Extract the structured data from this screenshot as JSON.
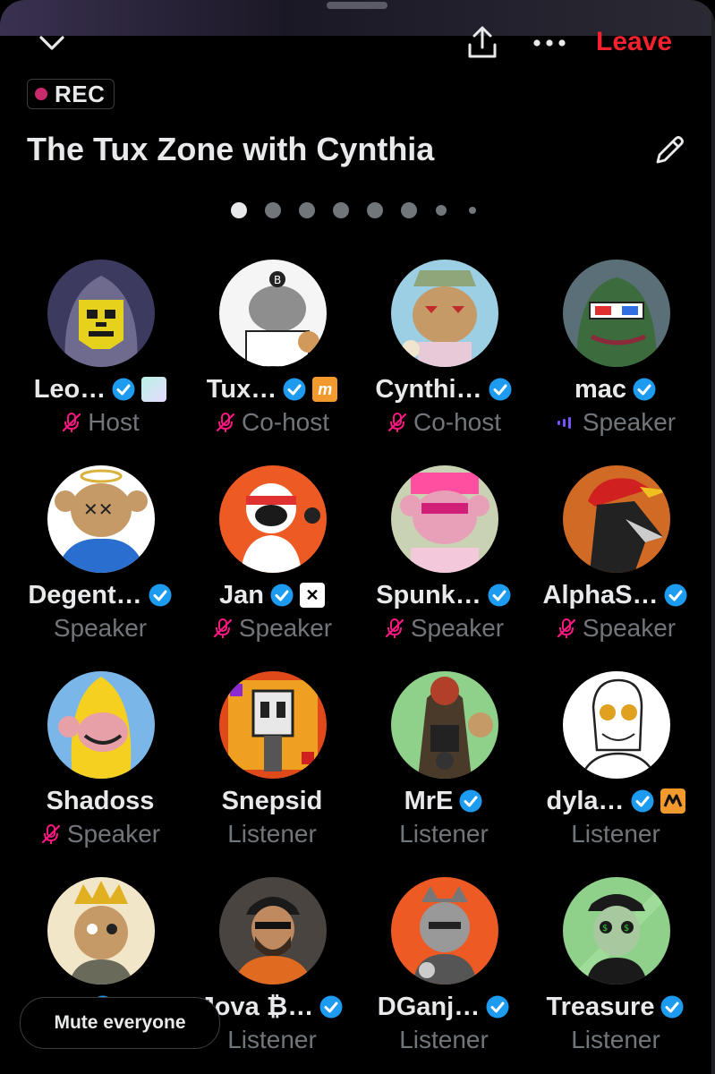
{
  "header": {
    "leave_label": "Leave",
    "rec_label": "REC",
    "title": "The Tux Zone with Cynthia",
    "page_indicator": {
      "total": 8,
      "current": 1
    }
  },
  "colors": {
    "accent_red": "#f4212e",
    "verified_blue": "#1d9bf0",
    "muted_pink": "#f91880",
    "speaking_purple": "#7856ff"
  },
  "participants": [
    {
      "name": "Leo…",
      "role": "Host",
      "verified": true,
      "mic_off": true,
      "affiliate": "gradient-tile",
      "avatar": "skull-hooded"
    },
    {
      "name": "Tux…",
      "role": "Co-host",
      "verified": true,
      "mic_off": true,
      "affiliate": "m",
      "avatar": "cartoon-bitcoin"
    },
    {
      "name": "Cynthi…",
      "role": "Co-host",
      "verified": true,
      "mic_off": true,
      "affiliate": "",
      "avatar": "bear-hat"
    },
    {
      "name": "mac",
      "role": "Speaker",
      "verified": true,
      "speaking": true,
      "affiliate": "",
      "avatar": "frog-3d-glasses"
    },
    {
      "name": "Degent…",
      "role": "Speaker",
      "verified": true,
      "affiliate": "",
      "avatar": "bear-halo"
    },
    {
      "name": "Jan",
      "role": "Speaker",
      "verified": true,
      "mic_off": true,
      "affiliate": "x",
      "avatar": "astronaut"
    },
    {
      "name": "Spunk…",
      "role": "Speaker",
      "verified": true,
      "mic_off": true,
      "affiliate": "",
      "avatar": "pink-bear"
    },
    {
      "name": "AlphaS…",
      "role": "Speaker",
      "verified": true,
      "mic_off": true,
      "affiliate": "",
      "avatar": "dog-cap"
    },
    {
      "name": "Shadoss",
      "role": "Speaker",
      "verified": false,
      "mic_off": true,
      "affiliate": "",
      "avatar": "banana-monkey"
    },
    {
      "name": "Snepsid",
      "role": "Listener",
      "verified": false,
      "affiliate": "",
      "avatar": "pixel-robot"
    },
    {
      "name": "MrE",
      "role": "Listener",
      "verified": true,
      "affiliate": "",
      "avatar": "creature-green"
    },
    {
      "name": "dyla…",
      "role": "Listener",
      "verified": true,
      "affiliate": "orange-logo",
      "avatar": "sketch-man"
    },
    {
      "name": "",
      "role": "",
      "verified": true,
      "affiliate": "",
      "avatar": "crowned-bear"
    },
    {
      "name": "Jova ₿…",
      "role": "Listener",
      "verified": true,
      "affiliate": "",
      "avatar": "man-cap"
    },
    {
      "name": "DGanj…",
      "role": "Listener",
      "verified": true,
      "affiliate": "",
      "avatar": "bear-bw"
    },
    {
      "name": "Treasure",
      "role": "Listener",
      "verified": true,
      "affiliate": "",
      "avatar": "alien-green"
    }
  ],
  "footer": {
    "mute_everyone_label": "Mute everyone"
  }
}
